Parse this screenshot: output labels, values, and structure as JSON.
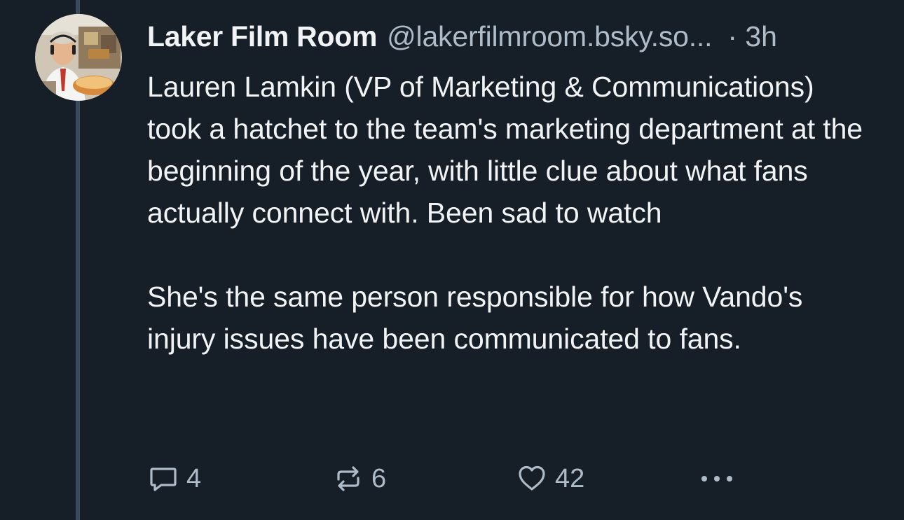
{
  "post": {
    "author": {
      "display_name": "Laker Film Room",
      "handle": "@lakerfilmroom.bsky.so...",
      "avatar": "profile-photo"
    },
    "timestamp": "· 3h",
    "paragraphs": [
      "Lauren Lamkin (VP of Marketing & Communications) took a hatchet to the team's marketing department at the beginning of the year, with little clue about what fans actually connect with. Been sad to watch",
      "She's the same person responsible for how Vando's injury issues have been communicated to fans."
    ],
    "actions": {
      "reply": {
        "icon": "reply-icon",
        "count": "4"
      },
      "repost": {
        "icon": "repost-icon",
        "count": "6"
      },
      "like": {
        "icon": "heart-icon",
        "count": "42"
      },
      "more": {
        "icon": "more-icon"
      }
    }
  },
  "colors": {
    "background": "#161e27",
    "text_primary": "#f1f3f5",
    "text_secondary": "#aebbc9",
    "thread_line": "#3a4a5a"
  }
}
